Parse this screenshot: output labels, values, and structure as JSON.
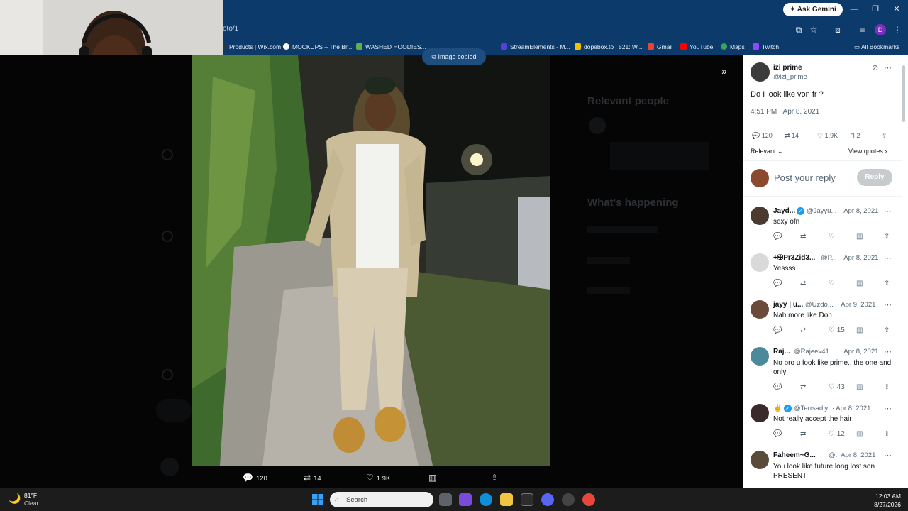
{
  "browser": {
    "ask_gemini": "Ask Gemini",
    "url_fragment": "oto/1",
    "profile_initial": "D",
    "bookmarks": [
      {
        "label": "Products | Wix.com",
        "color": "#333333"
      },
      {
        "label": "MOCKUPS – The Br...",
        "color": "#ffffff"
      },
      {
        "label": "WASHED HOODIES...",
        "color": "#5fb04f"
      },
      {
        "label": "StreamElements - M...",
        "color": "#5a3fd6"
      },
      {
        "label": "dopebox.to | 521: W...",
        "color": "#f2c200"
      },
      {
        "label": "Gmail",
        "color": "#ea4335"
      },
      {
        "label": "YouTube",
        "color": "#ff0000"
      },
      {
        "label": "Maps",
        "color": "#34a853"
      },
      {
        "label": "Twitch",
        "color": "#9146ff"
      }
    ],
    "all_bookmarks": "All Bookmarks"
  },
  "toast": {
    "label": "Image copied"
  },
  "photo_actions": {
    "replies": "120",
    "reposts": "14",
    "likes": "1.9K"
  },
  "tweet": {
    "name": "izi prime",
    "handle": "@izi_prime",
    "text": "Do I look like von fr ?",
    "timestamp": "4:51 PM · Apr 8, 2021",
    "replies": "120",
    "reposts": "14",
    "likes": "1.9K",
    "bookmarks": "2",
    "sort": "Relevant",
    "view_quotes": "View quotes",
    "reply_placeholder": "Post your reply",
    "reply_button": "Reply"
  },
  "replies": [
    {
      "name": "Jayd...",
      "handle": "@Jayyu...",
      "date": "· Apr 8, 2021",
      "text": "sexy ofn",
      "likes": "",
      "verified": true
    },
    {
      "name": "+✠Pr3Zid3...",
      "handle": "@P...",
      "date": "· Apr 8, 2021",
      "text": "Yessss",
      "likes": "",
      "verified": false
    },
    {
      "name": "jayy | u...",
      "handle": "@Uzdo...",
      "date": "· Apr 9, 2021",
      "text": "Nah more like Don",
      "likes": "15",
      "verified": false
    },
    {
      "name": "Raj...",
      "handle": "@Rajeev41...",
      "date": "· Apr 8, 2021",
      "text": "No bro u look like prime.. the one and only",
      "likes": "43",
      "verified": false
    },
    {
      "name": "✌️",
      "handle": "@Terrsadly",
      "date": "· Apr 8, 2021",
      "text": "Not really accept the hair",
      "likes": "12",
      "verified": true
    },
    {
      "name": "Faheem~G...",
      "handle": "@.",
      "date": "· Apr 8, 2021",
      "text": "You look like future long lost son PRESENT",
      "likes": "",
      "verified": false
    }
  ],
  "background": {
    "relevant_people": "Relevant people",
    "whats_happening": "What's happening"
  },
  "taskbar": {
    "temp": "81°F",
    "condition": "Clear",
    "search": "Search",
    "time": "12:03 AM",
    "date": "8/27/2026"
  }
}
